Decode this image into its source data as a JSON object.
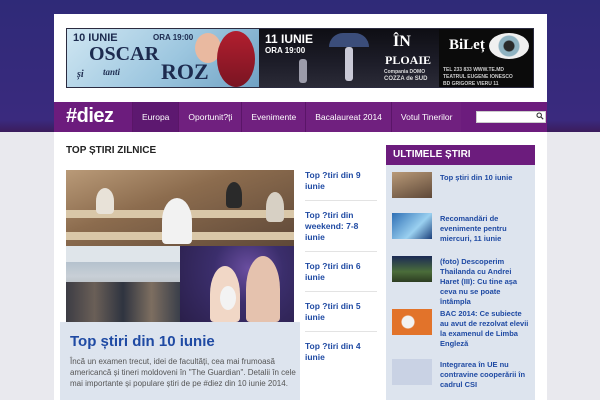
{
  "colors": {
    "nav_purple": "#6c1c7d",
    "link_blue": "#1f4aa3",
    "card_bg": "#dde4ee",
    "page_top": "#2f2a78"
  },
  "banner": {
    "left": {
      "date": "10 IUNIE",
      "time": "ORA 19:00",
      "title_oscar": "OSCAR",
      "title_si": "și",
      "title_tanti": "tanti",
      "title_roz": "ROZ"
    },
    "center": {
      "date": "11 IUNIE",
      "time": "ORA 19:00",
      "title_in": "ÎN",
      "title_ploaie": "PLOAIE",
      "company": "Compania DOMO",
      "company2": "COZZA de SUD"
    },
    "right": {
      "brand": "BiLeț",
      "phone": "TEL 233 833 WWW.TE.MD",
      "theatre": "TEATRUL EUGENE IONESCO",
      "address": "BD GRIGORE VIERU 11"
    }
  },
  "header": {
    "logo_hash": "#",
    "logo_text": "diez",
    "nav": [
      "Europa",
      "Oportunit?ți",
      "Evenimente",
      "Bacalaureat 2014",
      "Votul Tinerilor"
    ],
    "search_placeholder": ""
  },
  "main": {
    "section_title": "TOP ȘTIRI ZILNICE",
    "headline": "Top știri din 10 iunie",
    "text": "Încă un examen trecut, idei de facultăți, cea mai frumoasă americancă și tineri moldoveni în \"The Guardian\". Detalii în cele mai importante și populare știri de pe #diez din 10 iunie 2014.",
    "list": [
      "Top ?tiri din 9 iunie",
      "Top ?tiri din weekend: 7-8 iunie",
      "Top ?tiri din 6 iunie",
      "Top ?tiri din 5 iunie",
      "Top ?tiri din 4 iunie"
    ]
  },
  "sidebar": {
    "title": "ULTIMELE ȘTIRI",
    "items": [
      {
        "text": "Top știri din 10 iunie"
      },
      {
        "text": "Recomandări de evenimente pentru miercuri, 11 iunie"
      },
      {
        "text": "(foto) Descoperim Thailanda cu Andrei Haret (III): Cu tine așa ceva nu se poate întâmpla"
      },
      {
        "text": "BAC 2014: Ce subiecte au avut de rezolvat elevii la examenul de Limba Engleză"
      },
      {
        "text": "Integrarea în UE nu contravine cooperării în cadrul CSI"
      }
    ]
  }
}
